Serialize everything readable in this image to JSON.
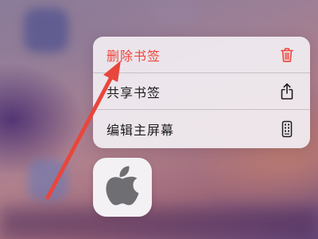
{
  "context_menu": {
    "items": [
      {
        "label": "删除书签",
        "icon": "trash-icon",
        "destructive": true
      },
      {
        "label": "共享书签",
        "icon": "share-icon",
        "destructive": false
      },
      {
        "label": "编辑主屏幕",
        "icon": "phone-icon",
        "destructive": false
      }
    ]
  },
  "app_icon": {
    "icon": "apple-logo-icon"
  },
  "colors": {
    "destructive": "#f0443a",
    "text": "#1c1c1e",
    "annotation_arrow": "#e8463c",
    "apple_logo": "#6e6e73"
  }
}
